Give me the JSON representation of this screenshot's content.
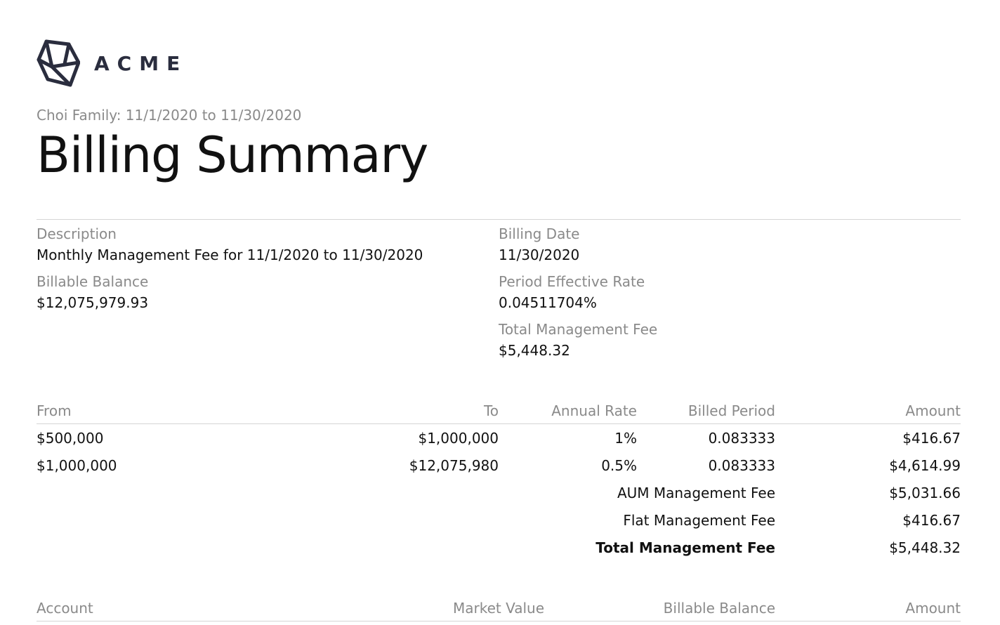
{
  "brand": {
    "name": "ACME",
    "logo_icon": "wireframe-cube-icon",
    "color": "#2a2d3e"
  },
  "header": {
    "subtitle": "Choi Family: 11/1/2020 to 11/30/2020",
    "title": "Billing Summary"
  },
  "summary": {
    "description_label": "Description",
    "description_value": "Monthly Management Fee for 11/1/2020 to 11/30/2020",
    "billable_balance_label": "Billable Balance",
    "billable_balance_value": "$12,075,979.93",
    "billing_date_label": "Billing Date",
    "billing_date_value": "11/30/2020",
    "period_rate_label": "Period Effective Rate",
    "period_rate_value": "0.04511704%",
    "total_fee_label": "Total Management Fee",
    "total_fee_value": "$5,448.32"
  },
  "tiers": {
    "headers": {
      "from": "From",
      "to": "To",
      "annual_rate": "Annual Rate",
      "billed_period": "Billed Period",
      "amount": "Amount"
    },
    "rows": [
      {
        "from": "$500,000",
        "to": "$1,000,000",
        "annual_rate": "1%",
        "billed_period": "0.083333",
        "amount": "$416.67"
      },
      {
        "from": "$1,000,000",
        "to": "$12,075,980",
        "annual_rate": "0.5%",
        "billed_period": "0.083333",
        "amount": "$4,614.99"
      }
    ],
    "totals": [
      {
        "label": "AUM Management Fee",
        "value": "$5,031.66"
      },
      {
        "label": "Flat Management Fee",
        "value": "$416.67"
      },
      {
        "label": "Total Management Fee",
        "value": "$5,448.32"
      }
    ]
  },
  "accounts": {
    "headers": {
      "account": "Account",
      "market_value": "Market Value",
      "billable_balance": "Billable Balance",
      "amount": "Amount"
    }
  }
}
